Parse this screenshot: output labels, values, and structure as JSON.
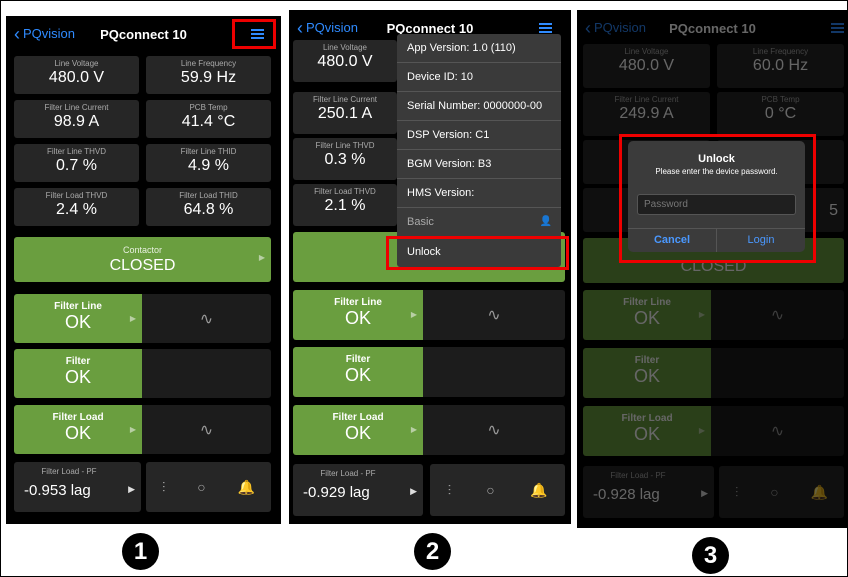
{
  "screens": [
    {
      "nav": {
        "back": "PQvision",
        "title": "PQconnect 10"
      },
      "tiles": [
        {
          "label": "Line Voltage",
          "value": "480.0 V"
        },
        {
          "label": "Line Frequency",
          "value": "59.9 Hz"
        },
        {
          "label": "Filter Line Current",
          "value": "98.9 A"
        },
        {
          "label": "PCB Temp",
          "value": "41.4 °C"
        },
        {
          "label": "Filter Line THVD",
          "value": "0.7 %"
        },
        {
          "label": "Filter Line THID",
          "value": "4.9 %"
        },
        {
          "label": "Filter Load THVD",
          "value": "2.4 %"
        },
        {
          "label": "Filter Load THID",
          "value": "64.8 %"
        }
      ],
      "contactor": {
        "label": "Contactor",
        "value": "CLOSED"
      },
      "status": [
        {
          "label": "Filter Line",
          "value": "OK"
        },
        {
          "label": "Filter",
          "value": "OK"
        },
        {
          "label": "Filter Load",
          "value": "OK"
        }
      ],
      "pf": {
        "label": "Filter Load - PF",
        "value": "-0.953 lag"
      },
      "step": "1"
    },
    {
      "nav": {
        "back": "PQvision",
        "title": "PQconnect 10"
      },
      "tiles": [
        {
          "label": "Line Voltage",
          "value": "480.0 V"
        },
        {
          "label": "Filter Line Current",
          "value": "250.1 A"
        },
        {
          "label": "Filter Line THVD",
          "value": "0.3 %"
        },
        {
          "label": "Filter Load THVD",
          "value": "2.1 %"
        }
      ],
      "contactor": {
        "value": "C"
      },
      "menu": [
        "App Version: 1.0 (110)",
        "Device ID: 10",
        "Serial Number: 0000000-00",
        "DSP Version: C1",
        "BGM Version: B3",
        "HMS Version:",
        "Basic",
        "Unlock"
      ],
      "status": [
        {
          "label": "Filter Line",
          "value": "OK"
        },
        {
          "label": "Filter",
          "value": "OK"
        },
        {
          "label": "Filter Load",
          "value": "OK"
        }
      ],
      "pf": {
        "label": "Filter Load - PF",
        "value": "-0.929 lag"
      },
      "step": "2"
    },
    {
      "nav": {
        "back": "PQvision",
        "title": "PQconnect 10"
      },
      "tiles": [
        {
          "label": "Line Voltage",
          "value": "480.0 V"
        },
        {
          "label": "Line Frequency",
          "value": "60.0 Hz"
        },
        {
          "label": "Filter Line Current",
          "value": "249.9 A"
        },
        {
          "label": "PCB Temp",
          "value": "0 °C"
        },
        {
          "label": "",
          "value": "5"
        }
      ],
      "contactor": {
        "value": "CLOSED"
      },
      "dialog": {
        "title": "Unlock",
        "message": "Please enter the device password.",
        "placeholder": "Password",
        "cancel": "Cancel",
        "login": "Login"
      },
      "status": [
        {
          "label": "Filter Line",
          "value": "OK"
        },
        {
          "label": "Filter",
          "value": "OK"
        },
        {
          "label": "Filter Load",
          "value": "OK"
        }
      ],
      "pf": {
        "label": "Filter Load - PF",
        "value": "-0.928 lag"
      },
      "step": "3"
    }
  ],
  "icons": {
    "sine": "sine-wave-icon",
    "mixer": "sliders-icon",
    "refresh": "circle-icon",
    "alarm": "alarm-bell-icon",
    "person": "person-icon"
  },
  "colors": {
    "ok_green": "#6a9e3f",
    "accent_blue": "#2f8bff",
    "highlight_red": "#e00000"
  }
}
